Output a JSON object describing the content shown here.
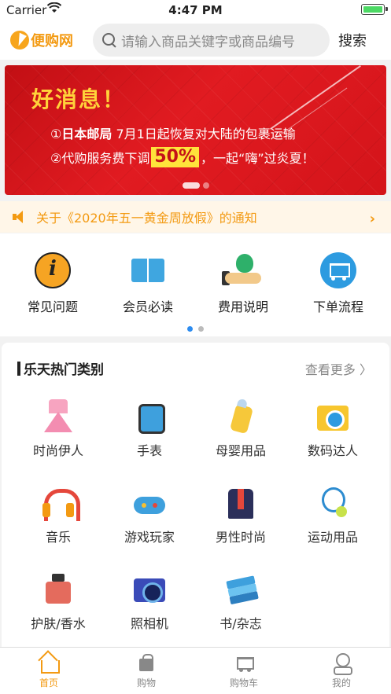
{
  "status_bar": {
    "carrier": "Carrier",
    "time": "4:47 PM"
  },
  "header": {
    "logo_text": "便购网",
    "search_placeholder": "请输入商品关键字或商品编号",
    "search_button": "搜索"
  },
  "banner": {
    "headline": "好消息！",
    "line1_prefix": "①",
    "line1_bold": "日本邮局",
    "line1_rest": " 7月1日起恢复对大陆的包裹运输",
    "line2_prefix": "②代购服务费下调",
    "line2_percent": "50%",
    "line2_suffix": "，一起“嗨”过炎夏！"
  },
  "notice": {
    "text": "关于《2020年五一黄金周放假》的通知"
  },
  "shortcuts": [
    {
      "label": "常见问题",
      "icon": "question-info-icon"
    },
    {
      "label": "会员必读",
      "icon": "book-icon"
    },
    {
      "label": "费用说明",
      "icon": "money-bag-icon"
    },
    {
      "label": "下单流程",
      "icon": "shopping-cart-icon"
    }
  ],
  "hot_categories": {
    "title": "乐天热门类别",
    "more": "查看更多 〉",
    "items": [
      {
        "label": "时尚伊人",
        "icon": "dress-icon"
      },
      {
        "label": "手表",
        "icon": "watch-icon"
      },
      {
        "label": "母婴用品",
        "icon": "baby-bottle-icon"
      },
      {
        "label": "数码达人",
        "icon": "camera-icon"
      },
      {
        "label": "音乐",
        "icon": "headphones-icon"
      },
      {
        "label": "游戏玩家",
        "icon": "gamepad-icon"
      },
      {
        "label": "男性时尚",
        "icon": "suit-icon"
      },
      {
        "label": "运动用品",
        "icon": "tennis-icon"
      },
      {
        "label": "护肤/香水",
        "icon": "perfume-icon"
      },
      {
        "label": "照相机",
        "icon": "photo-camera-icon"
      },
      {
        "label": "书/杂志",
        "icon": "books-icon"
      }
    ]
  },
  "tabbar": [
    {
      "label": "首页",
      "icon": "home-icon",
      "active": true
    },
    {
      "label": "购物",
      "icon": "shopping-bag-icon",
      "active": false
    },
    {
      "label": "购物车",
      "icon": "cart-icon",
      "active": false
    },
    {
      "label": "我的",
      "icon": "user-icon",
      "active": false
    }
  ],
  "colors": {
    "accent": "#f39a12",
    "banner_red": "#d4141a",
    "pager_active": "#2d8cf0"
  }
}
